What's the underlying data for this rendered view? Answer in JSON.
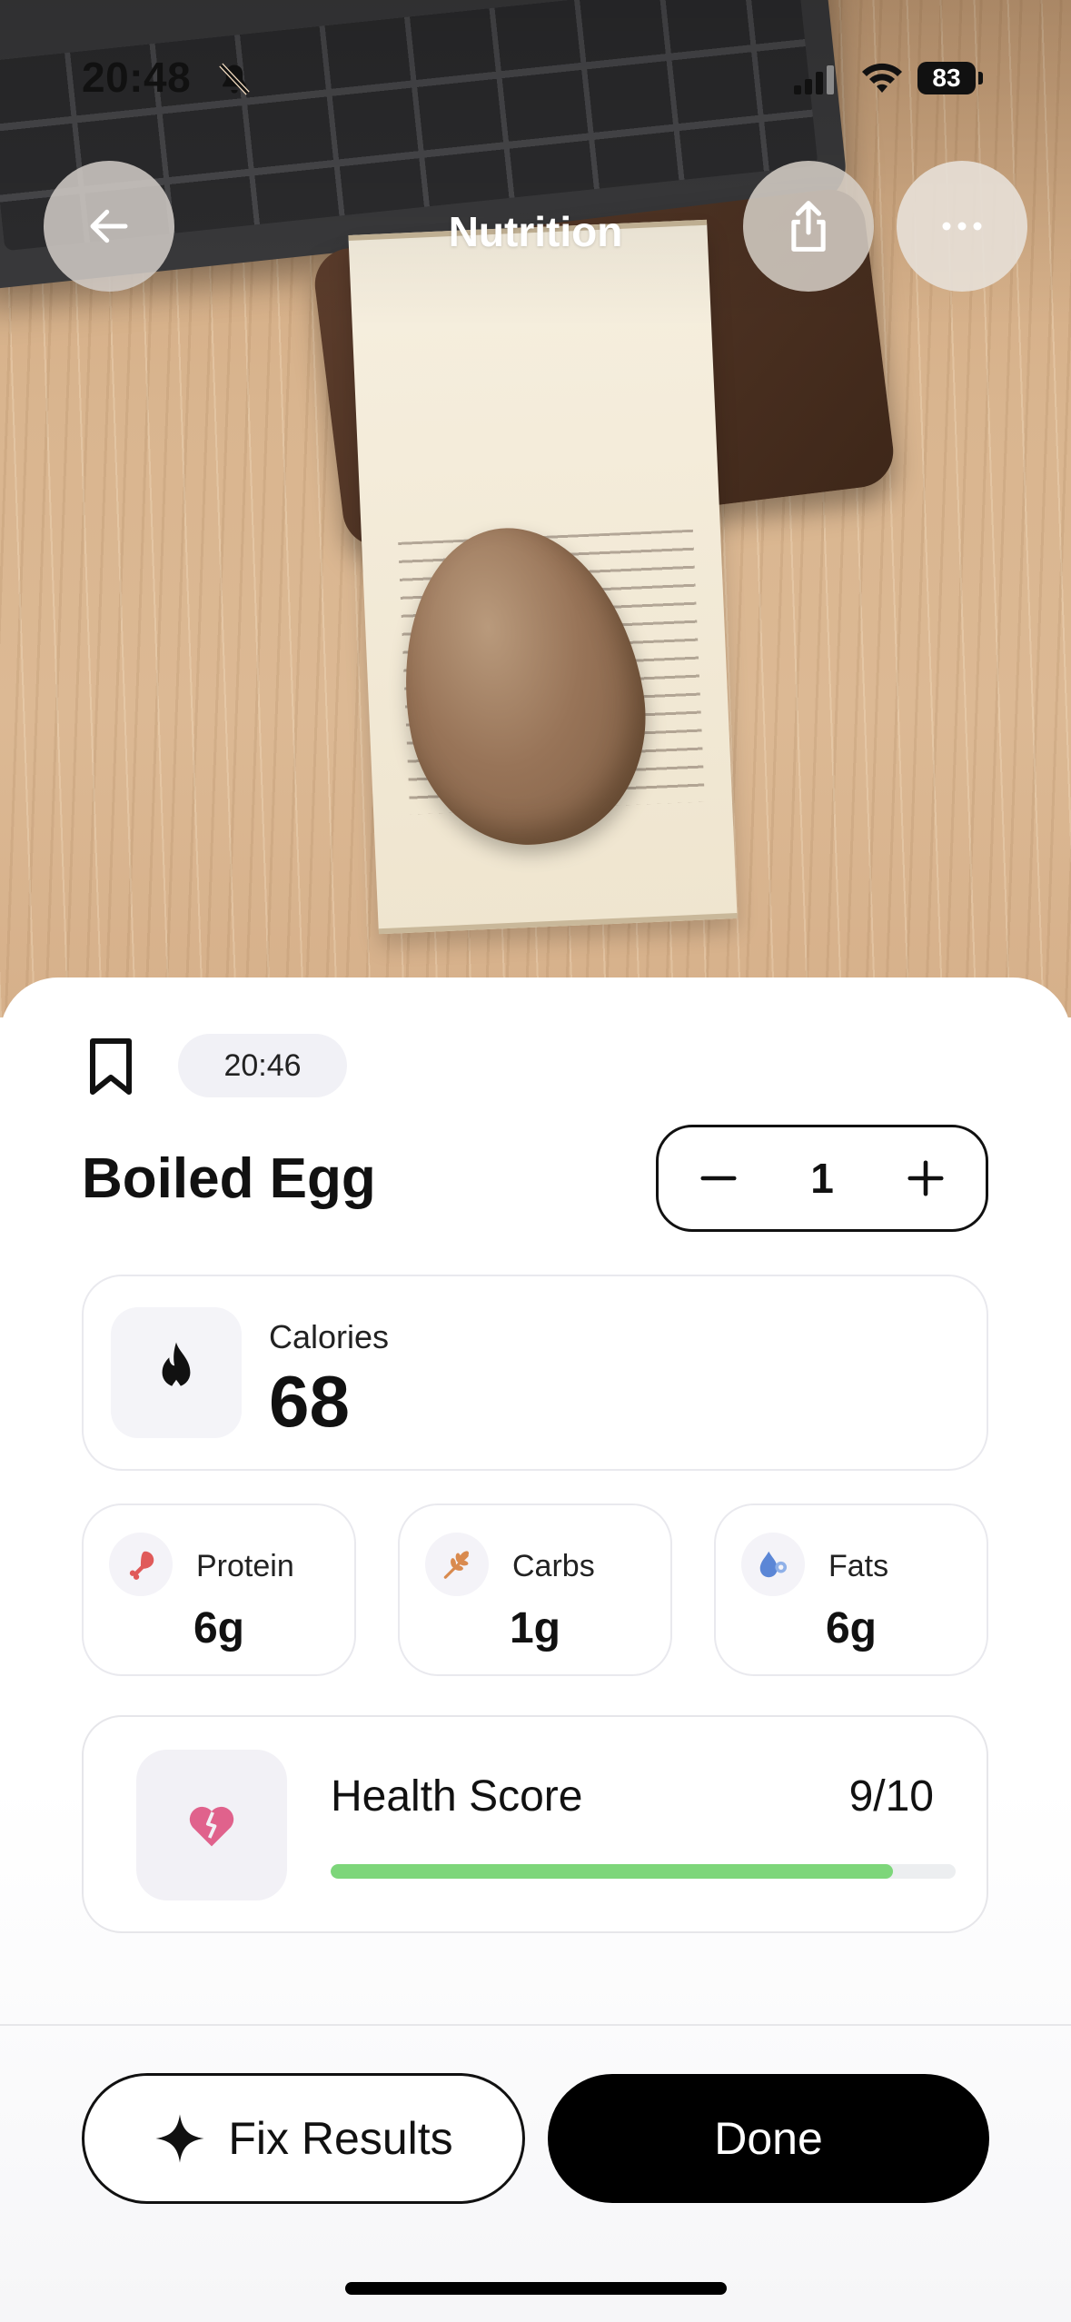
{
  "status_bar": {
    "time": "20:48",
    "battery": "83",
    "icons": [
      "bell-slash-icon",
      "cellular-signal-icon",
      "wifi-icon",
      "battery-icon"
    ]
  },
  "nav": {
    "title": "Nutrition",
    "back_icon": "arrow-left-icon",
    "share_icon": "share-icon",
    "more_icon": "ellipsis-icon"
  },
  "entry": {
    "time": "20:46",
    "food_name": "Boiled Egg",
    "quantity": "1"
  },
  "calories": {
    "label": "Calories",
    "value": "68",
    "icon": "flame-icon"
  },
  "macros": [
    {
      "label": "Protein",
      "value": "6g",
      "icon": "drumstick-icon",
      "color": "#e05a5a"
    },
    {
      "label": "Carbs",
      "value": "1g",
      "icon": "wheat-icon",
      "color": "#d98a4f"
    },
    {
      "label": "Fats",
      "value": "6g",
      "icon": "oil-drop-icon",
      "color": "#5b86d6"
    }
  ],
  "health": {
    "label": "Health Score",
    "value": "9/10",
    "score_fraction": 0.9,
    "icon": "heart-icon",
    "bar_color": "#7dd67a",
    "icon_color": "#e0628c"
  },
  "actions": {
    "fix_label": "Fix Results",
    "done_label": "Done",
    "fix_icon": "sparkle-icon"
  }
}
